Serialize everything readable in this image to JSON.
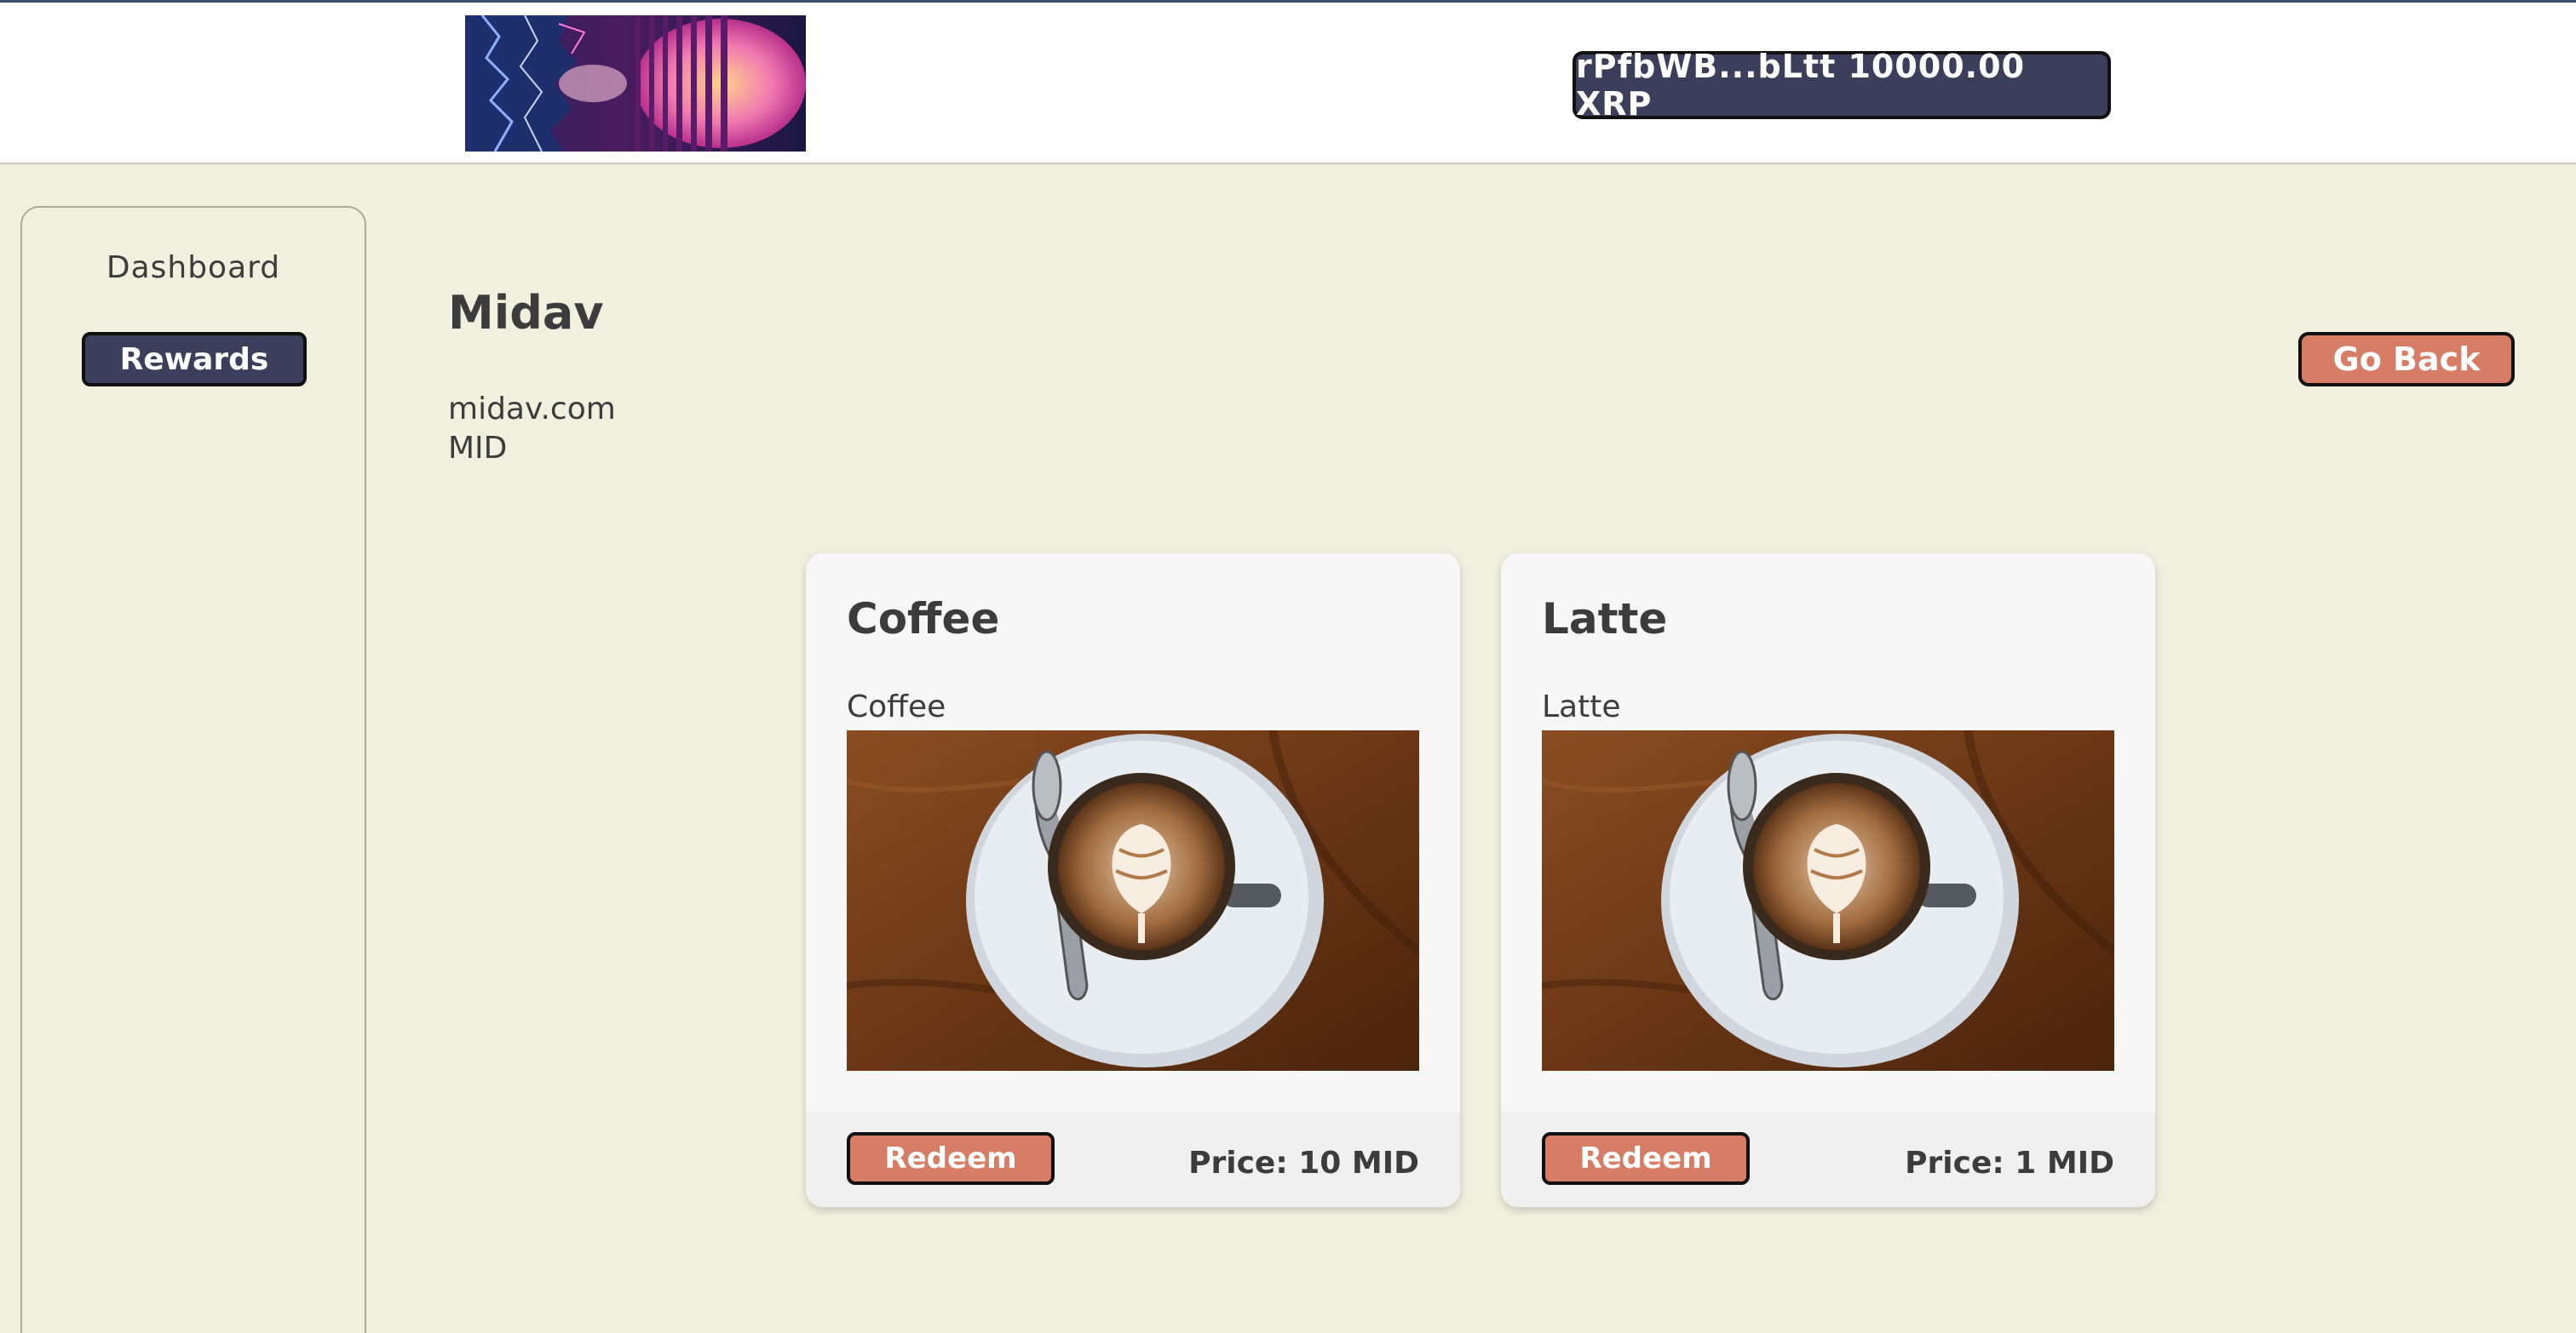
{
  "header": {
    "wallet_label": "rPfbWB...bLtt 10000.00 XRP"
  },
  "sidebar": {
    "items": [
      {
        "label": "Dashboard",
        "active": false
      },
      {
        "label": "Rewards",
        "active": true
      }
    ]
  },
  "brand": {
    "name": "Midav",
    "website": "midav.com",
    "ticker": "MID"
  },
  "actions": {
    "go_back_label": "Go Back"
  },
  "rewards": [
    {
      "title": "Coffee",
      "description": "Coffee",
      "image_icon": "latte-art-photo",
      "redeem_label": "Redeem",
      "price_label": "Price: 10 MID"
    },
    {
      "title": "Latte",
      "description": "Latte",
      "image_icon": "latte-art-photo",
      "redeem_label": "Redeem",
      "price_label": "Price: 1 MID"
    }
  ],
  "colors": {
    "page_bg": "#f1f0de",
    "navy_button": "#3c3f5c",
    "accent_button": "#d77d66",
    "card_bg": "#f7f7f7",
    "text": "#3c3c3c"
  }
}
